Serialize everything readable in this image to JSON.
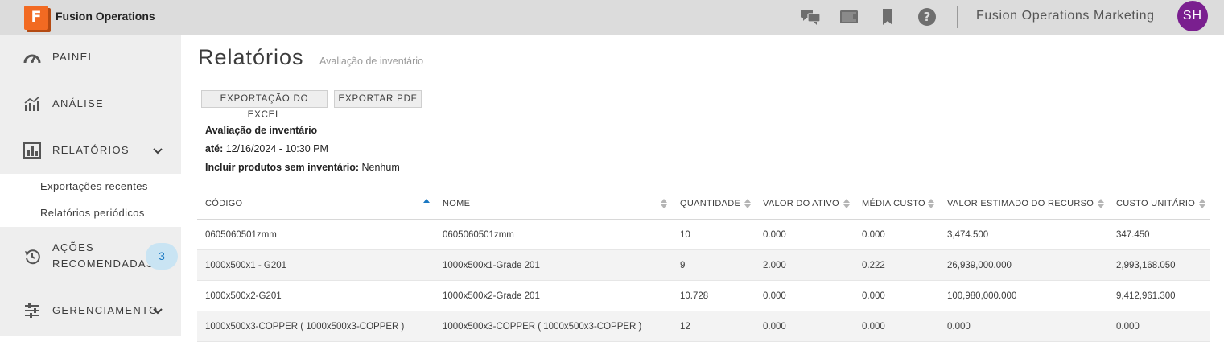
{
  "app": {
    "logo_letter": "F",
    "title": "Fusion Operations",
    "org_name": "Fusion Operations Marketing",
    "avatar_initials": "SH",
    "brand_color": "#f26a22",
    "avatar_color": "#7a1f8f"
  },
  "topbar_icons": [
    "chat-icon",
    "video-icon",
    "bookmark-icon",
    "help-icon"
  ],
  "sidebar": {
    "items": [
      {
        "label": "PAINEL",
        "icon": "dashboard-gauge-icon"
      },
      {
        "label": "ANÁLISE",
        "icon": "analytics-chart-icon"
      },
      {
        "label": "RELATÓRIOS",
        "icon": "reports-bar-icon"
      },
      {
        "label": "AÇÕES",
        "label2": "RECOMENDADAS",
        "icon": "history-clock-icon",
        "badge": "3"
      },
      {
        "label": "GERENCIAMENTO",
        "icon": "sliders-icon"
      }
    ],
    "subitems": [
      "Exportações recentes",
      "Relatórios periódicos"
    ]
  },
  "page": {
    "title": "Relatórios",
    "subtitle": "Avaliação de inventário",
    "export_excel": "EXPORTAÇÃO DO EXCEL",
    "export_pdf": "EXPORTAR PDF",
    "report_name": "Avaliação de inventário",
    "until_label": "até:",
    "until_value": "12/16/2024 - 10:30 PM",
    "include_label": "Incluir produtos sem inventário:",
    "include_value": "Nenhum"
  },
  "table": {
    "headers": [
      "CÓDIGO",
      "NOME",
      "QUANTIDADE",
      "VALOR DO ATIVO",
      "MÉDIA CUSTO",
      "VALOR ESTIMADO DO RECURSO",
      "CUSTO UNITÁRIO"
    ],
    "sorted_column": "CÓDIGO",
    "rows": [
      [
        "0605060501zmm",
        "0605060501zmm",
        "10",
        "0.000",
        "0.000",
        "3,474.500",
        "347.450"
      ],
      [
        "1000x500x1 - G201",
        "1000x500x1-Grade 201",
        "9",
        "2.000",
        "0.222",
        "26,939,000.000",
        "2,993,168.050"
      ],
      [
        "1000x500x2-G201",
        "1000x500x2-Grade 201",
        "10.728",
        "0.000",
        "0.000",
        "100,980,000.000",
        "9,412,961.300"
      ],
      [
        "1000x500x3-COPPER ( 1000x500x3-COPPER )",
        "1000x500x3-COPPER ( 1000x500x3-COPPER )",
        "12",
        "0.000",
        "0.000",
        "0.000",
        "0.000"
      ]
    ]
  },
  "colors": {
    "topbar_bg": "#dcdcdc",
    "sidebar_bg": "#eeeeee",
    "badge_bg": "#c9e4f3",
    "badge_text": "#1a78c2",
    "sort_active": "#1a78c2"
  }
}
